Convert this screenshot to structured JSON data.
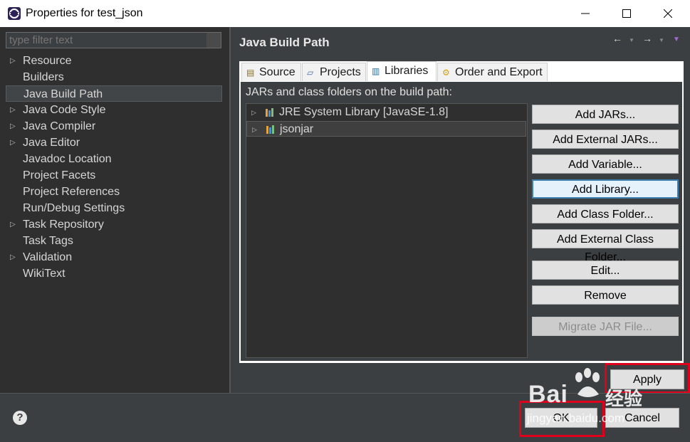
{
  "window": {
    "title": "Properties for test_json",
    "controls": [
      "—",
      "☐",
      "✕"
    ]
  },
  "filter": {
    "placeholder": "type filter text"
  },
  "nav": {
    "items": [
      {
        "label": "Resource",
        "expandable": true
      },
      {
        "label": "Builders",
        "expandable": false
      },
      {
        "label": "Java Build Path",
        "expandable": false,
        "selected": true
      },
      {
        "label": "Java Code Style",
        "expandable": true
      },
      {
        "label": "Java Compiler",
        "expandable": true
      },
      {
        "label": "Java Editor",
        "expandable": true
      },
      {
        "label": "Javadoc Location",
        "expandable": false
      },
      {
        "label": "Project Facets",
        "expandable": false
      },
      {
        "label": "Project References",
        "expandable": false
      },
      {
        "label": "Run/Debug Settings",
        "expandable": false
      },
      {
        "label": "Task Repository",
        "expandable": true
      },
      {
        "label": "Task Tags",
        "expandable": false
      },
      {
        "label": "Validation",
        "expandable": true
      },
      {
        "label": "WikiText",
        "expandable": false
      }
    ]
  },
  "page": {
    "title": "Java Build Path",
    "nav_arrows": {
      "back": "←",
      "forward": "→",
      "menu": "▼"
    }
  },
  "tabs": [
    {
      "label": "Source",
      "icon": "source-folder-icon"
    },
    {
      "label": "Projects",
      "icon": "projects-icon"
    },
    {
      "label": "Libraries",
      "icon": "libraries-icon",
      "active": true
    },
    {
      "label": "Order and Export",
      "icon": "order-export-icon"
    }
  ],
  "libraries": {
    "label": "JARs and class folders on the build path:",
    "entries": [
      {
        "label": "JRE System Library [JavaSE-1.8]"
      },
      {
        "label": "jsonjar",
        "selected": true
      }
    ]
  },
  "buttons": {
    "add_jars": "Add JARs...",
    "add_external_jars": "Add External JARs...",
    "add_variable": "Add Variable...",
    "add_library": "Add Library...",
    "add_class_folder": "Add Class Folder...",
    "add_external_class_folder": "Add External Class Folder...",
    "edit": "Edit...",
    "remove": "Remove",
    "migrate_jar": "Migrate JAR File...",
    "apply": "Apply",
    "ok": "OK",
    "cancel": "Cancel"
  },
  "watermark": {
    "brand": "Bai",
    "brand_cn": "经验",
    "url": "jingyan.baidu.com"
  },
  "colors": {
    "highlight_box": "#e0001b",
    "focus_border": "#3c7fb1"
  }
}
